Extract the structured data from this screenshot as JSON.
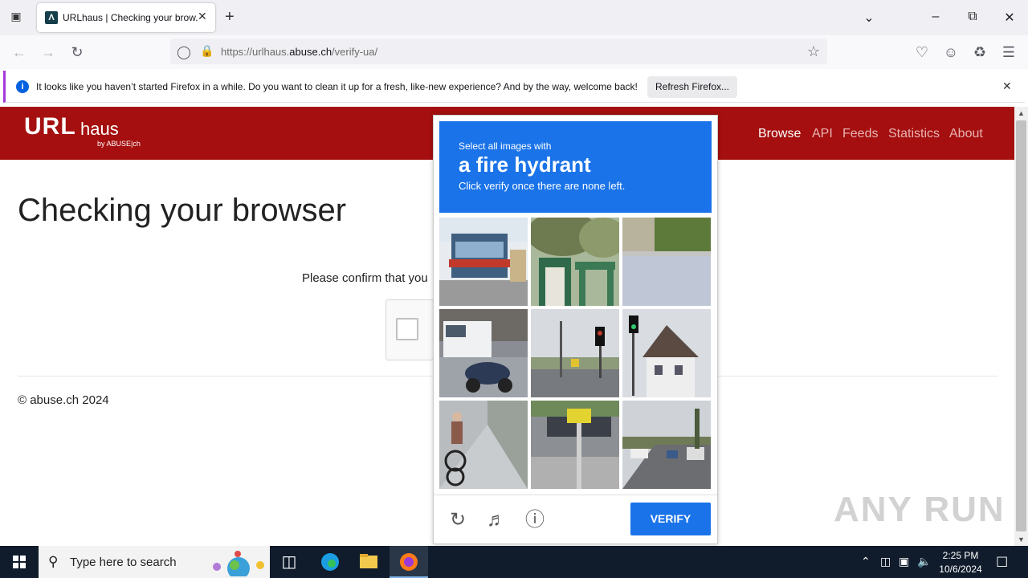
{
  "browser": {
    "tab_title": "URLhaus | Checking your brow...",
    "url_prefix": "https://urlhaus.",
    "url_domain": "abuse.ch",
    "url_path": "/verify-ua/",
    "notification": "It looks like you haven’t started Firefox in a while. Do you want to clean it up for a fresh, like-new experience? And by the way, welcome back!",
    "notification_button": "Refresh Firefox..."
  },
  "site": {
    "logo_main": "URL",
    "logo_sub": "haus",
    "logo_by": "by ABUSE|ch",
    "nav": [
      "Browse",
      "API",
      "Feeds",
      "Statistics",
      "About"
    ],
    "page_title": "Checking your browser",
    "confirm_text": "Please confirm that you",
    "footer": "© abuse.ch 2024"
  },
  "challenge": {
    "select_label": "Select all images with",
    "target": "a fire hydrant",
    "hint": "Click verify once there are none left.",
    "verify_label": "VERIFY",
    "tiles": [
      "storefront street",
      "green gate with trees",
      "road with guardrail",
      "van and motorcycle",
      "traffic light at intersection",
      "traffic light and house",
      "cyclist on sidewalk",
      "parking lot with sign",
      "highway traffic"
    ]
  },
  "watermark": "ANY RUN",
  "taskbar": {
    "search_placeholder": "Type here to search",
    "time": "2:25 PM",
    "date": "10/6/2024"
  },
  "colors": {
    "header_red": "#a50f0f",
    "challenge_blue": "#1a73e8"
  }
}
